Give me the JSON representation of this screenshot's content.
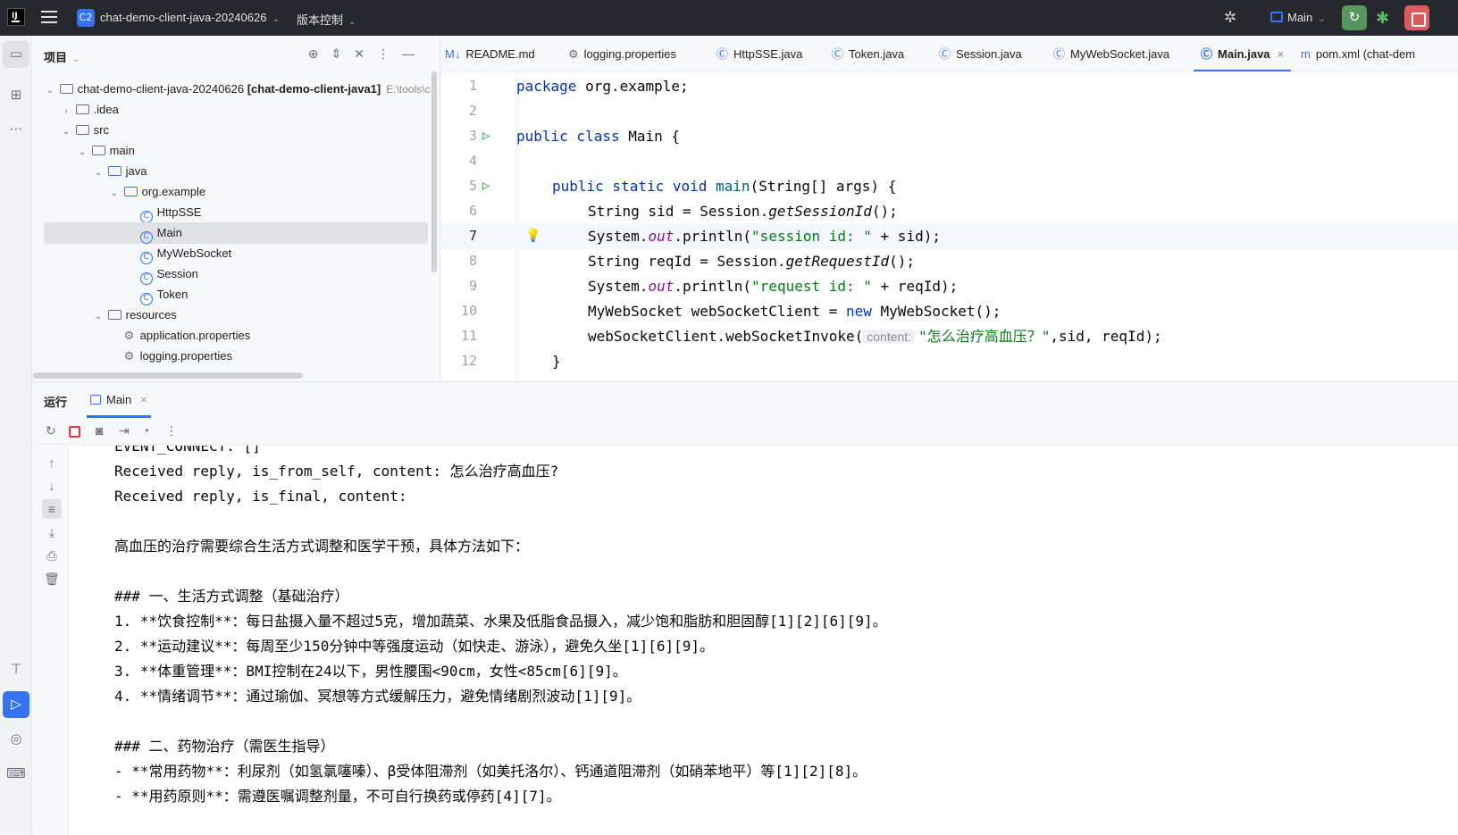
{
  "titlebar": {
    "project_badge": "C2",
    "project_name": "chat-demo-client-java-20240626",
    "vcs_label": "版本控制",
    "run_config": "Main"
  },
  "project_panel": {
    "title": "项目",
    "tree": [
      {
        "label": "chat-demo-client-java-20240626",
        "bold_suffix": "[chat-demo-client-java1]",
        "path": "E:\\tools\\c",
        "icon": "folder-icon",
        "depth": 0,
        "arrow": "down"
      },
      {
        "label": ".idea",
        "icon": "folder-icon",
        "depth": 1,
        "arrow": "right"
      },
      {
        "label": "src",
        "icon": "folder-icon",
        "depth": 1,
        "arrow": "down"
      },
      {
        "label": "main",
        "icon": "folder-icon",
        "depth": 2,
        "arrow": "down"
      },
      {
        "label": "java",
        "icon": "source-folder-icon",
        "depth": 3,
        "arrow": "down"
      },
      {
        "label": "org.example",
        "icon": "package-icon",
        "depth": 4,
        "arrow": "down"
      },
      {
        "label": "HttpSSE",
        "icon": "class-icon",
        "depth": 5
      },
      {
        "label": "Main",
        "icon": "class-icon",
        "depth": 5,
        "selected": true
      },
      {
        "label": "MyWebSocket",
        "icon": "class-icon",
        "depth": 5
      },
      {
        "label": "Session",
        "icon": "class-icon",
        "depth": 5
      },
      {
        "label": "Token",
        "icon": "class-icon",
        "depth": 5
      },
      {
        "label": "resources",
        "icon": "folder-icon",
        "depth": 3,
        "arrow": "down"
      },
      {
        "label": "application.properties",
        "icon": "gear-icon",
        "depth": 4
      },
      {
        "label": "logging.properties",
        "icon": "gear-icon",
        "depth": 4
      }
    ]
  },
  "editor": {
    "tabs": [
      {
        "label": "README.md",
        "icon": "M↓"
      },
      {
        "label": "logging.properties",
        "icon": "⚙"
      },
      {
        "label": "HttpSSE.java",
        "icon": "Ⓒ"
      },
      {
        "label": "Token.java",
        "icon": "Ⓒ"
      },
      {
        "label": "Session.java",
        "icon": "Ⓒ"
      },
      {
        "label": "MyWebSocket.java",
        "icon": "Ⓒ"
      },
      {
        "label": "Main.java",
        "icon": "Ⓒ",
        "active": true
      },
      {
        "label": "pom.xml (chat-dem",
        "icon": "m"
      }
    ],
    "line_numbers": [
      "1",
      "2",
      "3",
      "4",
      "5",
      "6",
      "7",
      "8",
      "9",
      "10",
      "11",
      "12"
    ],
    "code": {
      "l1_kw": "package",
      "l1_rest": " org.example;",
      "l3_kw": "public class",
      "l3_rest": " Main {",
      "l5_kw": "public static void",
      "l5_fn": "main",
      "l5_rest": "(String[] args) {",
      "l6_a": "String sid = Session.",
      "l6_it": "getSessionId",
      "l6_b": "();",
      "l7_a": "System.",
      "l7_out": "out",
      "l7_b": ".println(",
      "l7_str": "\"session id: \"",
      "l7_c": " + sid);",
      "l8_a": "String reqId = Session.",
      "l8_it": "getRequestId",
      "l8_b": "();",
      "l9_a": "System.",
      "l9_out": "out",
      "l9_b": ".println(",
      "l9_str": "\"request id: \"",
      "l9_c": " + reqId);",
      "l10_a": "MyWebSocket webSocketClient = ",
      "l10_kw": "new",
      "l10_b": " MyWebSocket();",
      "l11_a": "webSocketClient.webSocketInvoke(",
      "l11_hint": "content:",
      "l11_str": "\"怎么治疗高血压？\"",
      "l11_b": ",sid, reqId);",
      "l12": "}"
    }
  },
  "run_panel": {
    "title": "运行",
    "tab_label": "Main",
    "console_lines": [
      "EVENT_CONNECT: []",
      "Received reply, is_from_self, content: 怎么治疗高血压?",
      "Received reply, is_final, content:",
      "",
      "高血压的治疗需要综合生活方式调整和医学干预，具体方法如下：",
      "",
      "### 一、生活方式调整（基础治疗）",
      "1. **饮食控制**：每日盐摄入量不超过5克，增加蔬菜、水果及低脂食品摄入，减少饱和脂肪和胆固醇[1][2][6][9]。",
      "2. **运动建议**：每周至少150分钟中等强度运动（如快走、游泳），避免久坐[1][6][9]。",
      "3. **体重管理**：BMI控制在24以下，男性腰围<90cm，女性<85cm[6][9]。",
      "4. **情绪调节**：通过瑜伽、冥想等方式缓解压力，避免情绪剧烈波动[1][9]。",
      "",
      "### 二、药物治疗（需医生指导）",
      "- **常用药物**：利尿剂（如氢氯噻嗪）、β受体阻滞剂（如美托洛尔）、钙通道阻滞剂（如硝苯地平）等[1][2][8]。",
      "- **用药原则**：需遵医嘱调整剂量，不可自行换药或停药[4][7]。"
    ]
  }
}
